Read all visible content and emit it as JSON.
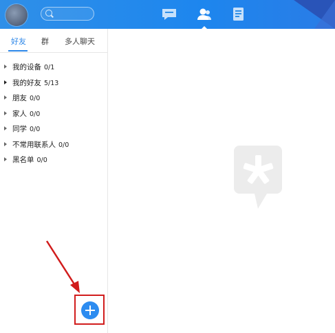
{
  "tabs": {
    "friends": "好友",
    "group": "群",
    "multi_chat": "多人聊天"
  },
  "groups": [
    {
      "name": "我的设备",
      "count": "0/1",
      "expanded": false
    },
    {
      "name": "我的好友",
      "count": "5/13",
      "expanded": true
    },
    {
      "name": "朋友",
      "count": "0/0",
      "expanded": false
    },
    {
      "name": "家人",
      "count": "0/0",
      "expanded": false
    },
    {
      "name": "同学",
      "count": "0/0",
      "expanded": false
    },
    {
      "name": "不常用联系人",
      "count": "0/0",
      "expanded": false
    },
    {
      "name": "黑名单",
      "count": "0/0",
      "expanded": false
    }
  ],
  "icons": {
    "top_nav": [
      "messages-icon",
      "contacts-icon",
      "space-icon"
    ],
    "search": "search-icon",
    "add": "plus-icon",
    "placeholder": "asterisk-bubble-icon"
  },
  "colors": {
    "header_blue": "#1d86ee",
    "accent": "#2b86e8",
    "add_button": "#2d8cf0",
    "annotation_red": "#d11c1c"
  }
}
